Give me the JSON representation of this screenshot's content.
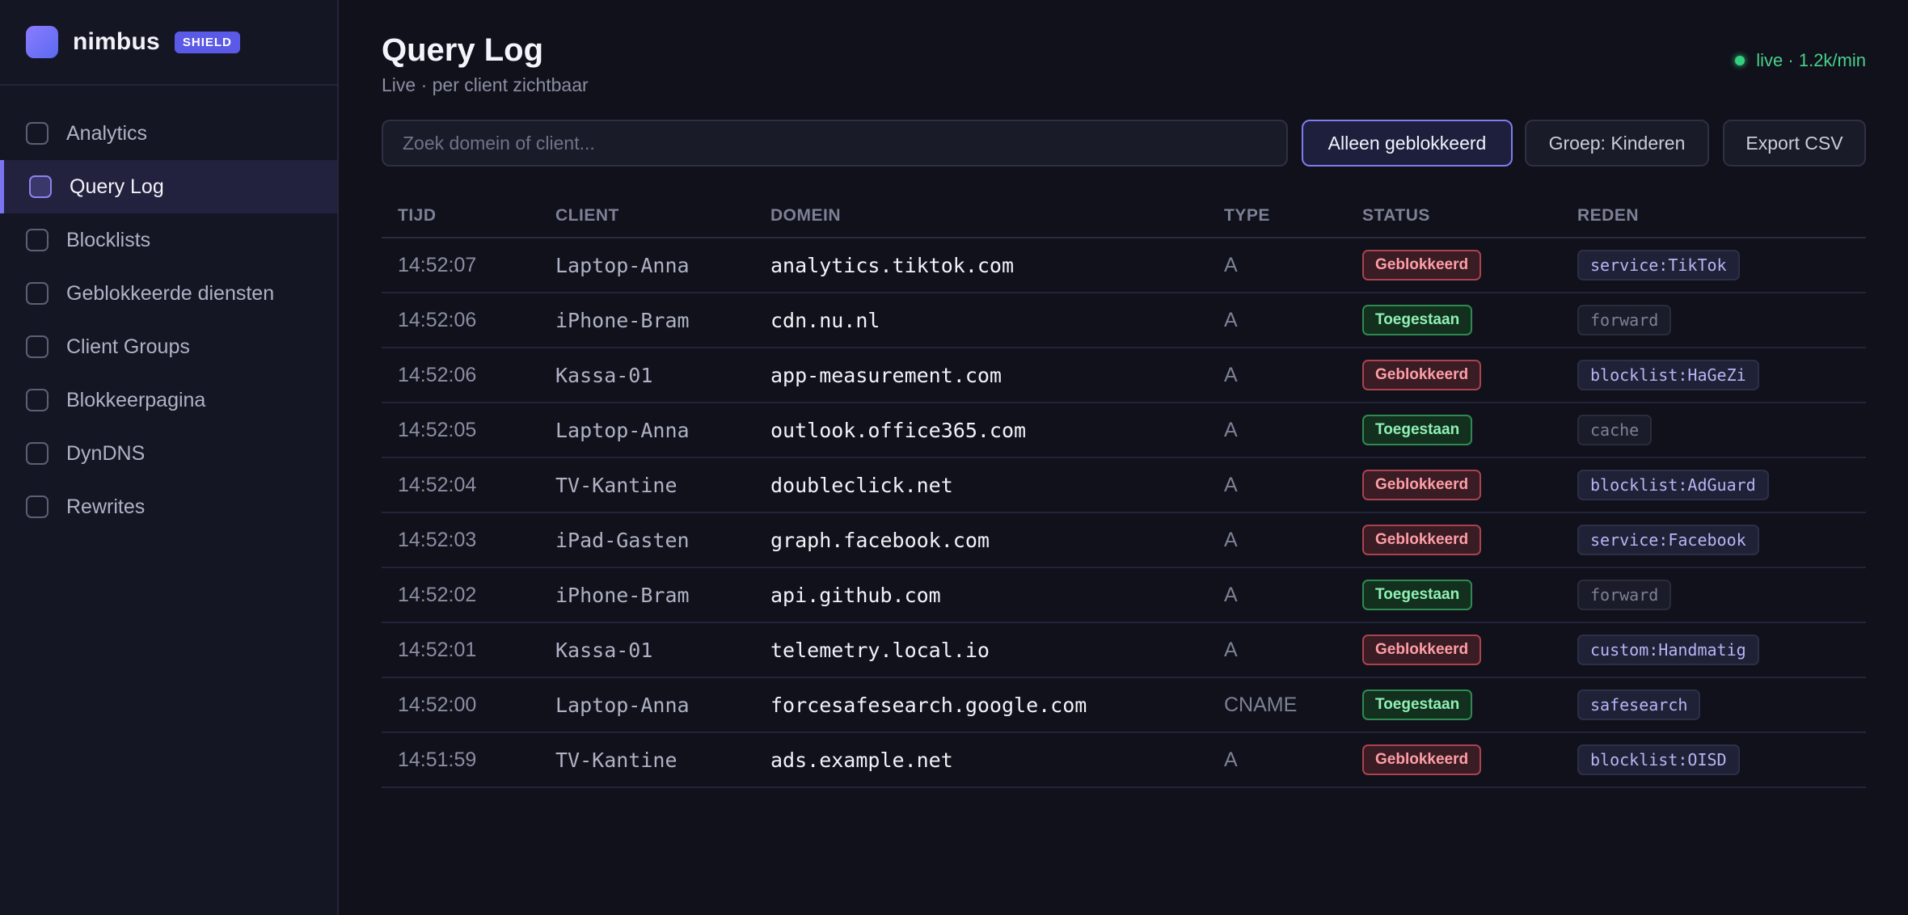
{
  "brand": {
    "name": "nimbus",
    "badge": "SHIELD"
  },
  "sidebar": {
    "items": [
      {
        "label": "Analytics",
        "active": false
      },
      {
        "label": "Query Log",
        "active": true
      },
      {
        "label": "Blocklists",
        "active": false
      },
      {
        "label": "Geblokkeerde diensten",
        "active": false
      },
      {
        "label": "Client Groups",
        "active": false
      },
      {
        "label": "Blokkeerpagina",
        "active": false
      },
      {
        "label": "DynDNS",
        "active": false
      },
      {
        "label": "Rewrites",
        "active": false
      }
    ]
  },
  "header": {
    "title": "Query Log",
    "subtitle": "Live · per client zichtbaar",
    "live_status": "live · 1.2k/min"
  },
  "toolbar": {
    "search_placeholder": "Zoek domein of client...",
    "search_value": "",
    "blocked_only_label": "Alleen geblokkeerd",
    "group_label": "Groep: Kinderen",
    "export_label": "Export CSV"
  },
  "table": {
    "headers": [
      "TIJD",
      "CLIENT",
      "DOMEIN",
      "TYPE",
      "STATUS",
      "REDEN"
    ],
    "rows": [
      {
        "time": "14:52:07",
        "client": "Laptop-Anna",
        "domain": "analytics.tiktok.com",
        "type": "A",
        "status": "Geblokkeerd",
        "blocked": true,
        "reason": "service:TikTok",
        "reason_muted": false
      },
      {
        "time": "14:52:06",
        "client": "iPhone-Bram",
        "domain": "cdn.nu.nl",
        "type": "A",
        "status": "Toegestaan",
        "blocked": false,
        "reason": "forward",
        "reason_muted": true
      },
      {
        "time": "14:52:06",
        "client": "Kassa-01",
        "domain": "app-measurement.com",
        "type": "A",
        "status": "Geblokkeerd",
        "blocked": true,
        "reason": "blocklist:HaGeZi",
        "reason_muted": false
      },
      {
        "time": "14:52:05",
        "client": "Laptop-Anna",
        "domain": "outlook.office365.com",
        "type": "A",
        "status": "Toegestaan",
        "blocked": false,
        "reason": "cache",
        "reason_muted": true
      },
      {
        "time": "14:52:04",
        "client": "TV-Kantine",
        "domain": "doubleclick.net",
        "type": "A",
        "status": "Geblokkeerd",
        "blocked": true,
        "reason": "blocklist:AdGuard",
        "reason_muted": false
      },
      {
        "time": "14:52:03",
        "client": "iPad-Gasten",
        "domain": "graph.facebook.com",
        "type": "A",
        "status": "Geblokkeerd",
        "blocked": true,
        "reason": "service:Facebook",
        "reason_muted": false
      },
      {
        "time": "14:52:02",
        "client": "iPhone-Bram",
        "domain": "api.github.com",
        "type": "A",
        "status": "Toegestaan",
        "blocked": false,
        "reason": "forward",
        "reason_muted": true
      },
      {
        "time": "14:52:01",
        "client": "Kassa-01",
        "domain": "telemetry.local.io",
        "type": "A",
        "status": "Geblokkeerd",
        "blocked": true,
        "reason": "custom:Handmatig",
        "reason_muted": false
      },
      {
        "time": "14:52:00",
        "client": "Laptop-Anna",
        "domain": "forcesafesearch.google.com",
        "type": "CNAME",
        "status": "Toegestaan",
        "blocked": false,
        "reason": "safesearch",
        "reason_muted": false
      },
      {
        "time": "14:51:59",
        "client": "TV-Kantine",
        "domain": "ads.example.net",
        "type": "A",
        "status": "Geblokkeerd",
        "blocked": true,
        "reason": "blocklist:OISD",
        "reason_muted": false
      }
    ]
  },
  "colors": {
    "accent": "#7b74f0",
    "live": "#35d07f",
    "blocked": "#ff9ea6",
    "allowed": "#8ff0b4"
  }
}
